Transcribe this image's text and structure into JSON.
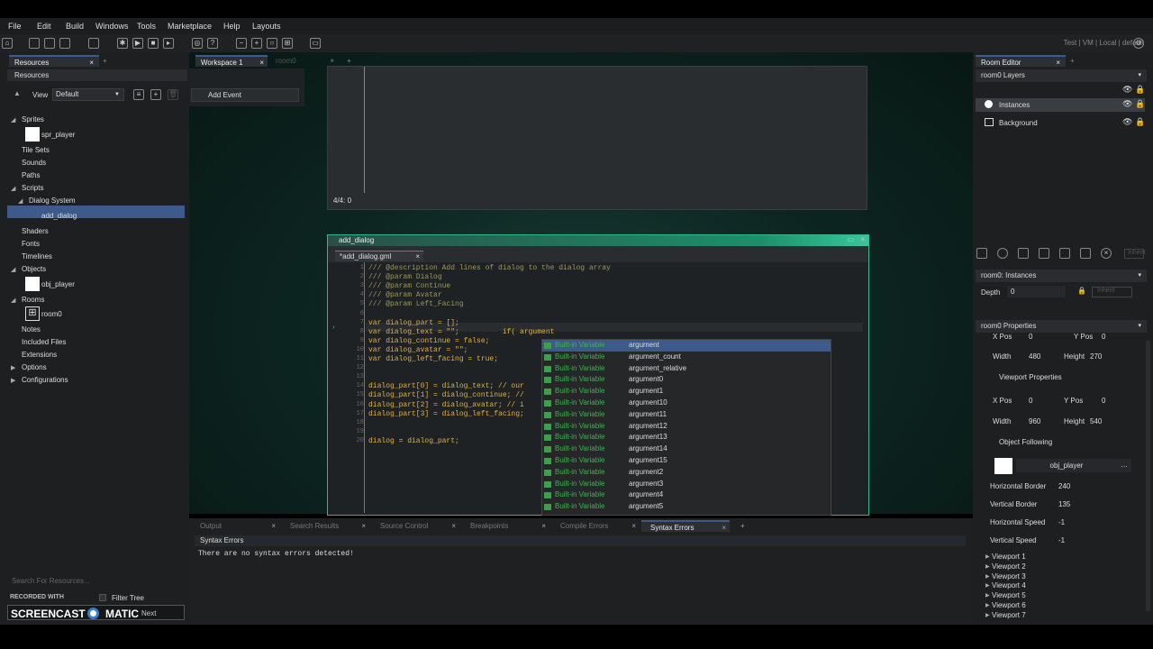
{
  "menu": [
    "File",
    "Edit",
    "Build",
    "Windows",
    "Tools",
    "Marketplace",
    "Help",
    "Layouts"
  ],
  "toolbar": {
    "target_text": "Test | VM | Local | default"
  },
  "left": {
    "tab_label": "Resources",
    "title": "Resources",
    "view_label": "View",
    "view_select": "Default",
    "tree": [
      {
        "label": "Sprites",
        "indent": 0,
        "arrow": "◢"
      },
      {
        "label": "spr_player",
        "indent": 2,
        "arrow": ""
      },
      {
        "label": "Tile Sets",
        "indent": 0,
        "arrow": ""
      },
      {
        "label": "Sounds",
        "indent": 0,
        "arrow": ""
      },
      {
        "label": "Paths",
        "indent": 0,
        "arrow": ""
      },
      {
        "label": "Scripts",
        "indent": 0,
        "arrow": "◢"
      },
      {
        "label": "Dialog System",
        "indent": 1,
        "arrow": "◢"
      },
      {
        "label": "add_dialog",
        "indent": 2,
        "arrow": ""
      },
      {
        "label": "Shaders",
        "indent": 0,
        "arrow": ""
      },
      {
        "label": "Fonts",
        "indent": 0,
        "arrow": ""
      },
      {
        "label": "Timelines",
        "indent": 0,
        "arrow": ""
      },
      {
        "label": "Objects",
        "indent": 0,
        "arrow": "◢"
      },
      {
        "label": "obj_player",
        "indent": 2,
        "arrow": ""
      },
      {
        "label": "Rooms",
        "indent": 0,
        "arrow": "◢"
      },
      {
        "label": "room0",
        "indent": 2,
        "arrow": ""
      },
      {
        "label": "Notes",
        "indent": 0,
        "arrow": ""
      },
      {
        "label": "Included Files",
        "indent": 0,
        "arrow": ""
      },
      {
        "label": "Extensions",
        "indent": 0,
        "arrow": ""
      },
      {
        "label": "Options",
        "indent": 0,
        "arrow": "▶"
      },
      {
        "label": "Configurations",
        "indent": 0,
        "arrow": "▶"
      }
    ],
    "search_placeholder": "Search For Resources...",
    "filter_tree": "Filter Tree",
    "next": "Next",
    "recorded_with": "RECORDED WITH",
    "screencast": "SCREENCAST",
    "matic": "MATIC"
  },
  "workspace": {
    "tabs": [
      "Workspace 1",
      "room0"
    ],
    "add_event": "Add Event",
    "status": "4/4: 0",
    "editor_title": "add_dialog",
    "file_tab": "*add_dialog.gml",
    "code_lines": [
      {
        "n": "1",
        "t": "/// @description Add lines of dialog to the dialog array"
      },
      {
        "n": "2",
        "t": "/// @param Dialog"
      },
      {
        "n": "3",
        "t": "/// @param Continue"
      },
      {
        "n": "4",
        "t": "/// @param Avatar"
      },
      {
        "n": "5",
        "t": "/// @param Left_Facing"
      },
      {
        "n": "6",
        "t": ""
      },
      {
        "n": "7",
        "t": "var dialog_part = [];"
      },
      {
        "n": "8",
        "t": "var dialog_text = \"\";          if( argument"
      },
      {
        "n": "9",
        "t": "var dialog_continue = false;"
      },
      {
        "n": "10",
        "t": "var dialog_avatar = \"\";"
      },
      {
        "n": "11",
        "t": "var dialog_left_facing = true;"
      },
      {
        "n": "12",
        "t": ""
      },
      {
        "n": "13",
        "t": ""
      },
      {
        "n": "14",
        "t": "dialog_part[0] = dialog_text; // our"
      },
      {
        "n": "15",
        "t": "dialog_part[1] = dialog_continue; //"
      },
      {
        "n": "16",
        "t": "dialog_part[2] = dialog_avatar; // i"
      },
      {
        "n": "17",
        "t": "dialog_part[3] = dialog_left_facing;"
      },
      {
        "n": "18",
        "t": ""
      },
      {
        "n": "19",
        "t": ""
      },
      {
        "n": "20",
        "t": "dialog = dialog_part;"
      }
    ],
    "autocomplete": [
      {
        "kind": "Built-in Variable",
        "name": "argument"
      },
      {
        "kind": "Built-in Variable",
        "name": "argument_count"
      },
      {
        "kind": "Built-in Variable",
        "name": "argument_relative"
      },
      {
        "kind": "Built-in Variable",
        "name": "argument0"
      },
      {
        "kind": "Built-in Variable",
        "name": "argument1"
      },
      {
        "kind": "Built-in Variable",
        "name": "argument10"
      },
      {
        "kind": "Built-in Variable",
        "name": "argument11"
      },
      {
        "kind": "Built-in Variable",
        "name": "argument12"
      },
      {
        "kind": "Built-in Variable",
        "name": "argument13"
      },
      {
        "kind": "Built-in Variable",
        "name": "argument14"
      },
      {
        "kind": "Built-in Variable",
        "name": "argument15"
      },
      {
        "kind": "Built-in Variable",
        "name": "argument2"
      },
      {
        "kind": "Built-in Variable",
        "name": "argument3"
      },
      {
        "kind": "Built-in Variable",
        "name": "argument4"
      },
      {
        "kind": "Built-in Variable",
        "name": "argument5"
      }
    ]
  },
  "output": {
    "tabs": [
      "Output",
      "Search Results",
      "Source Control",
      "Breakpoints",
      "Compile Errors",
      "Syntax Errors"
    ],
    "panel_title": "Syntax Errors",
    "message": "There are no syntax errors detected!"
  },
  "right": {
    "tab_label": "Room Editor",
    "layers_title": "room0 Layers",
    "layers": [
      "Instances",
      "Background"
    ],
    "instances_title": "room0: Instances",
    "depth_label": "Depth",
    "depth_value": "0",
    "inherit": "Inherit",
    "props_title": "room0 Properties",
    "xpos_label": "X Pos",
    "xpos_value": "0",
    "ypos_label": "Y Pos",
    "ypos_value": "0",
    "width_label": "Width",
    "width_value": "480",
    "height_label": "Height",
    "height_value": "270",
    "viewport_props": "Viewport Properties",
    "vp_xpos_value": "0",
    "vp_ypos_value": "0",
    "vp_width_value": "960",
    "vp_height_value": "540",
    "object_following": "Object Following",
    "object_value": "obj_player",
    "hborder_label": "Horizontal Border",
    "hborder_value": "240",
    "vborder_label": "Vertical Border",
    "vborder_value": "135",
    "hspeed_label": "Horizontal Speed",
    "hspeed_value": "-1",
    "vspeed_label": "Vertical Speed",
    "vspeed_value": "-1",
    "viewports": [
      "Viewport 1",
      "Viewport 2",
      "Viewport 3",
      "Viewport 4",
      "Viewport 5",
      "Viewport 6",
      "Viewport 7"
    ]
  },
  "colors": {
    "accent": "#3fb34f",
    "selection": "#3d5a8a"
  }
}
